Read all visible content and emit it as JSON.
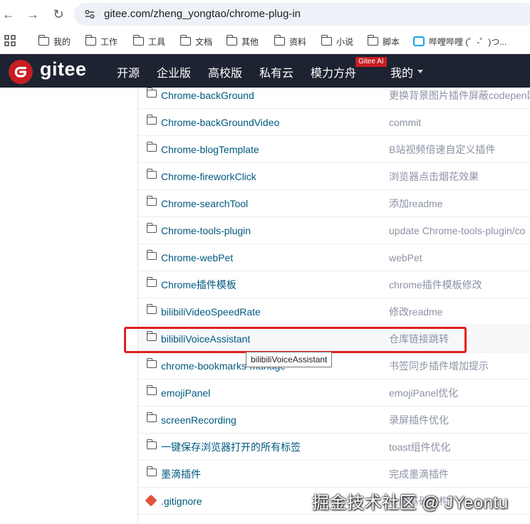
{
  "browser": {
    "url": "gitee.com/zheng_yongtao/chrome-plug-in",
    "bookmarks": [
      "我的",
      "工作",
      "工具",
      "文档",
      "其他",
      "资料",
      "小说",
      "脚本",
      "哔哩哔哩 (゜-゜)つ..."
    ]
  },
  "header": {
    "logo_text": "gitee",
    "nav": [
      "开源",
      "企业版",
      "高校版",
      "私有云",
      "模力方舟",
      "我的"
    ],
    "ai_badge": "Gitee AI"
  },
  "files": [
    {
      "name": "Chrome-backGround",
      "message": "更换背景图片插件屏蔽codepen网"
    },
    {
      "name": "Chrome-backGroundVideo",
      "message": "commit"
    },
    {
      "name": "Chrome-blogTemplate",
      "message": "B站视频倍速自定义插件"
    },
    {
      "name": "Chrome-fireworkClick",
      "message": "浏览器点击烟花效果"
    },
    {
      "name": "Chrome-searchTool",
      "message": "添加readme"
    },
    {
      "name": "Chrome-tools-plugin",
      "message": "update Chrome-tools-plugin/co"
    },
    {
      "name": "Chrome-webPet",
      "message": "webPet"
    },
    {
      "name": "Chrome插件模板",
      "message": "chrome插件模板修改"
    },
    {
      "name": "bilibiliVideoSpeedRate",
      "message": "修改readme"
    },
    {
      "name": "bilibiliVoiceAssistant",
      "message": "仓库链接跳转"
    },
    {
      "name": "chrome-bookmarks-manage",
      "message": "书签同步插件增加提示"
    },
    {
      "name": "emojiPanel",
      "message": "emojiPanel优化"
    },
    {
      "name": "screenRecording",
      "message": "录屏插件优化"
    },
    {
      "name": "一键保存浏览器打开的所有标签",
      "message": "toast组件优化"
    },
    {
      "name": "墨滴插件",
      "message": "完成墨滴插件"
    },
    {
      "name": ".gitignore",
      "message": "仓库基础结构"
    }
  ],
  "tooltip": "bilibiliVoiceAssistant",
  "watermark": "掘金技术社区 @ JYeontu",
  "colors": {
    "header_bg": "#1d2330",
    "brand": "#c71d23",
    "link": "#005980",
    "highlight": "#e02020"
  }
}
